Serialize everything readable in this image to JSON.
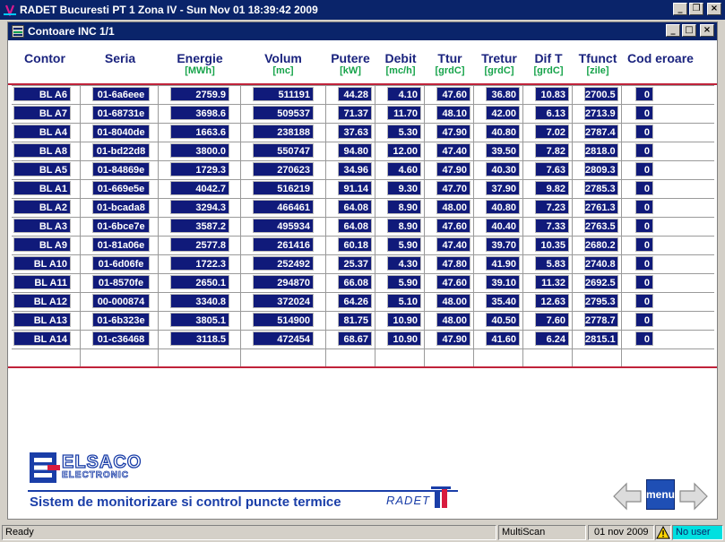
{
  "window": {
    "title": "RADET Bucuresti PT 1 Zona IV - Sun Nov 01 18:39:42 2009",
    "controls": {
      "minimize": "_",
      "restore": "❒",
      "close": "×"
    }
  },
  "child_window": {
    "title": "Contoare INC 1/1",
    "controls": {
      "minimize": "_",
      "maximize": "□",
      "close": "×"
    }
  },
  "table": {
    "columns": [
      {
        "label": "Contor",
        "unit": ""
      },
      {
        "label": "Seria",
        "unit": ""
      },
      {
        "label": "Energie",
        "unit": "[MWh]"
      },
      {
        "label": "Volum",
        "unit": "[mc]"
      },
      {
        "label": "Putere",
        "unit": "[kW]"
      },
      {
        "label": "Debit",
        "unit": "[mc/h]"
      },
      {
        "label": "Ttur",
        "unit": "[grdC]"
      },
      {
        "label": "Tretur",
        "unit": "[grdC]"
      },
      {
        "label": "Dif T",
        "unit": "[grdC]"
      },
      {
        "label": "Tfunct",
        "unit": "[zile]"
      },
      {
        "label": "Cod eroare",
        "unit": ""
      }
    ],
    "rows": [
      [
        "BL A6",
        "01-6a6eee",
        "2759.9",
        "511191",
        "44.28",
        "4.10",
        "47.60",
        "36.80",
        "10.83",
        "2700.5",
        "0"
      ],
      [
        "BL A7",
        "01-68731e",
        "3698.6",
        "509537",
        "71.37",
        "11.70",
        "48.10",
        "42.00",
        "6.13",
        "2713.9",
        "0"
      ],
      [
        "BL A4",
        "01-8040de",
        "1663.6",
        "238188",
        "37.63",
        "5.30",
        "47.90",
        "40.80",
        "7.02",
        "2787.4",
        "0"
      ],
      [
        "BL A8",
        "01-bd22d8",
        "3800.0",
        "550747",
        "94.80",
        "12.00",
        "47.40",
        "39.50",
        "7.82",
        "2818.0",
        "0"
      ],
      [
        "BL A5",
        "01-84869e",
        "1729.3",
        "270623",
        "34.96",
        "4.60",
        "47.90",
        "40.30",
        "7.63",
        "2809.3",
        "0"
      ],
      [
        "BL A1",
        "01-669e5e",
        "4042.7",
        "516219",
        "91.14",
        "9.30",
        "47.70",
        "37.90",
        "9.82",
        "2785.3",
        "0"
      ],
      [
        "BL A2",
        "01-bcada8",
        "3294.3",
        "466461",
        "64.08",
        "8.90",
        "48.00",
        "40.80",
        "7.23",
        "2761.3",
        "0"
      ],
      [
        "BL A3",
        "01-6bce7e",
        "3587.2",
        "495934",
        "64.08",
        "8.90",
        "47.60",
        "40.40",
        "7.33",
        "2763.5",
        "0"
      ],
      [
        "BL A9",
        "01-81a06e",
        "2577.8",
        "261416",
        "60.18",
        "5.90",
        "47.40",
        "39.70",
        "10.35",
        "2680.2",
        "0"
      ],
      [
        "BL A10",
        "01-6d06fe",
        "1722.3",
        "252492",
        "25.37",
        "4.30",
        "47.80",
        "41.90",
        "5.83",
        "2740.8",
        "0"
      ],
      [
        "BL A11",
        "01-8570fe",
        "2650.1",
        "294870",
        "66.08",
        "5.90",
        "47.60",
        "39.10",
        "11.32",
        "2692.5",
        "0"
      ],
      [
        "BL A12",
        "00-000874",
        "3340.8",
        "372024",
        "64.26",
        "5.10",
        "48.00",
        "35.40",
        "12.63",
        "2795.3",
        "0"
      ],
      [
        "BL A13",
        "01-6b323e",
        "3805.1",
        "514900",
        "81.75",
        "10.90",
        "48.00",
        "40.50",
        "7.60",
        "2778.7",
        "0"
      ],
      [
        "BL A14",
        "01-c36468",
        "3118.5",
        "472454",
        "68.67",
        "10.90",
        "47.90",
        "41.60",
        "6.24",
        "2815.1",
        "0"
      ]
    ]
  },
  "branding": {
    "logo_main": "ELSACO",
    "logo_sub": "ELECTRONIC",
    "tagline": "Sistem de monitorizare si control puncte termice",
    "radet_logo": "RADET"
  },
  "nav": {
    "menu_label": "menu",
    "back_icon": "arrow-left-icon",
    "forward_icon": "arrow-right-icon"
  },
  "statusbar": {
    "status": "Ready",
    "mode": "MultiScan",
    "date": "01 nov 2009",
    "user": "No user"
  },
  "colors": {
    "title_bar": "#0a246a",
    "cell_bg": "#101a7a",
    "header_text": "#1a237e",
    "unit_text": "#16a34a",
    "accent_line": "#c0223a"
  }
}
